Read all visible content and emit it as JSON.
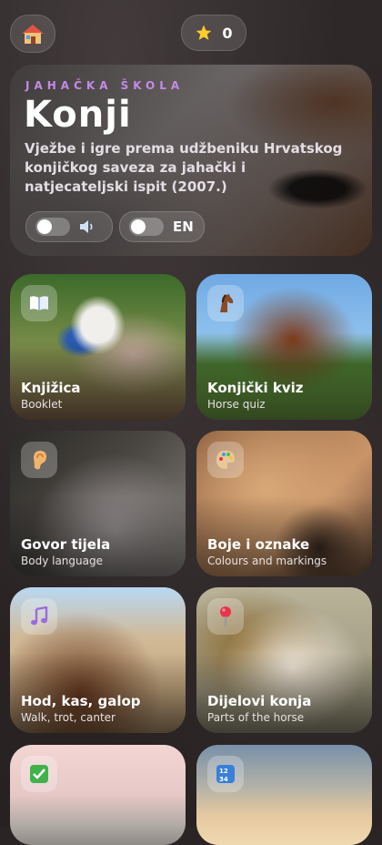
{
  "header": {
    "star_count": "0"
  },
  "hero": {
    "kicker": "JAHAČKA ŠKOLA",
    "title": "Konji",
    "description": "Vježbe i igre prema udžbeniku Hrvatskog konjičkog saveza za jahački i natjecateljski ispit (2007.)",
    "language_label": "EN"
  },
  "cards": [
    {
      "title": "Knjižica",
      "subtitle": "Booklet",
      "icon": "book-icon"
    },
    {
      "title": "Konjički kviz",
      "subtitle": "Horse quiz",
      "icon": "horse-head-icon"
    },
    {
      "title": "Govor tijela",
      "subtitle": "Body language",
      "icon": "ear-icon"
    },
    {
      "title": "Boje i oznake",
      "subtitle": "Colours and markings",
      "icon": "palette-icon"
    },
    {
      "title": "Hod, kas, galop",
      "subtitle": "Walk, trot, canter",
      "icon": "music-note-icon"
    },
    {
      "title": "Dijelovi konja",
      "subtitle": "Parts of the horse",
      "icon": "pin-icon"
    },
    {
      "title": "",
      "subtitle": "",
      "icon": "checkbox-icon"
    },
    {
      "title": "",
      "subtitle": "",
      "icon": "numbers-icon"
    }
  ],
  "colors": {
    "kicker": "#c58ae6",
    "background": "#2a2424"
  }
}
